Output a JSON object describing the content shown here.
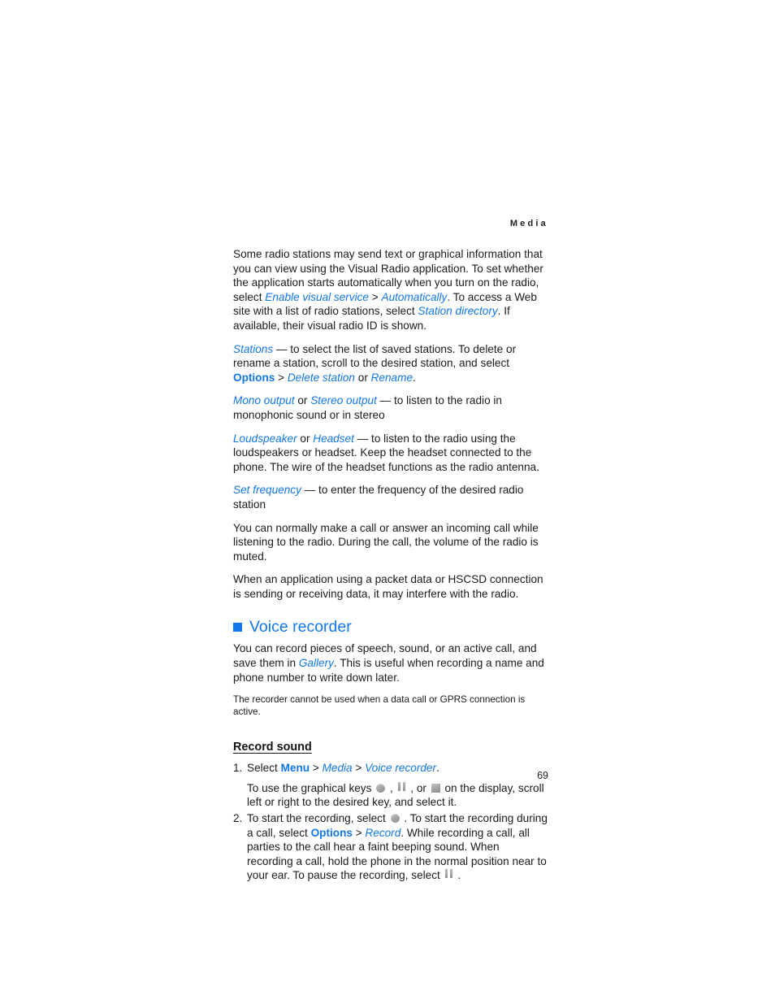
{
  "page": {
    "running_header": "Media",
    "page_number": "69",
    "accent_color": "#1277e8",
    "text_color": "#1b1b1b"
  },
  "paragraphs": {
    "p1": {
      "s1": "Some radio stations may send text or graphical information that you can view using the Visual Radio application. To set whether the application starts automatically when you turn on the radio, select ",
      "link1": "Enable visual service",
      "sep1": " > ",
      "link2": "Automatically",
      "s2": ". To access a Web site with a list of radio stations, select ",
      "link3": "Station directory",
      "s3": ". If available, their visual radio ID is shown."
    },
    "p2": {
      "link1": "Stations",
      "s1": " — to select the list of saved stations. To delete or rename a station, scroll to the desired station, and select ",
      "bold1": "Options",
      "sep1": " > ",
      "link2": "Delete station",
      "s2": " or ",
      "link3": "Rename",
      "s3": "."
    },
    "p3": {
      "link1": "Mono output",
      "s1": " or ",
      "link2": "Stereo output",
      "s2": " — to listen to the radio in monophonic sound or in stereo"
    },
    "p4": {
      "link1": "Loudspeaker",
      "s1": " or ",
      "link2": "Headset",
      "s2": " — to listen to the radio using the loudspeakers or headset. Keep the headset connected to the phone. The wire of the headset functions as the radio antenna."
    },
    "p5": {
      "link1": "Set frequency",
      "s1": " — to enter the frequency of the desired radio station"
    },
    "p6": {
      "s1": "You can normally make a call or answer an incoming call while listening to the radio. During the call, the volume of the radio is muted."
    },
    "p7": {
      "s1": "When an application using a packet data or HSCSD connection is sending or receiving data, it may interfere with the radio."
    }
  },
  "voice_recorder": {
    "heading": "Voice recorder",
    "intro": {
      "s1": "You can record pieces of speech, sound, or an active call, and save them in ",
      "link1": "Gallery",
      "s2": ". This is useful when recording a name and phone number to write down later."
    },
    "note": "The recorder cannot be used when a data call or GPRS connection is active.",
    "record_sound": {
      "heading": "Record sound",
      "step1": {
        "number": "1.",
        "s1": "Select ",
        "bold1": "Menu",
        "sep1": " > ",
        "link1": "Media",
        "sep2": " > ",
        "link2": "Voice recorder",
        "s2": ".",
        "sub_s1": "To use the graphical keys ",
        "icon1": "record-key-icon",
        "sub_s2": " , ",
        "icon2": "pause-key-icon",
        "sub_s3": " , or ",
        "icon3": "stop-key-icon",
        "sub_s4": " on the display, scroll left or right to the desired key, and select it."
      },
      "step2": {
        "number": "2.",
        "s1": "To start the recording, select ",
        "icon1": "record-key-icon",
        "s2": " . To start the recording during a call, select ",
        "bold1": "Options",
        "sep1": " > ",
        "link1": "Record",
        "s3": ". While recording a call, all parties to the call hear a faint beeping sound. When recording a call, hold the phone in the normal position near to your ear. To pause the recording, select ",
        "icon2": "pause-key-icon",
        "s4": " ."
      }
    }
  }
}
